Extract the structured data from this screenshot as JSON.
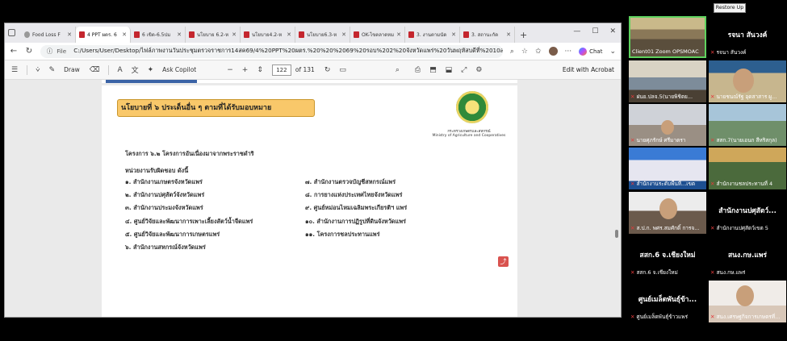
{
  "restore_button": "Restore Up",
  "browser": {
    "tabs": [
      {
        "label": "Food Loss F",
        "active": false
      },
      {
        "label": "4 PPT ผตร. 6",
        "active": true
      },
      {
        "label": "6 เขิต-6.5ปม",
        "active": false
      },
      {
        "label": "นโยบาย 6.2-ห",
        "active": false
      },
      {
        "label": "นโยบาย4.2-ห",
        "active": false
      },
      {
        "label": "นโยบาย6.3-ห",
        "active": false
      },
      {
        "label": "OK-ไขตลาดหม",
        "active": false
      },
      {
        "label": "3. งานตามนัด",
        "active": false
      },
      {
        "label": "3. สถานะกัด",
        "active": false
      }
    ],
    "new_tab": "+",
    "address": {
      "file_tag": "File",
      "url": "C:/Users/User/Desktop/ไฟล์ภาพงานวันประชุมตรวจราชการ14สค69/4%20PPT%20ผตร.%20%20%2069%20รอบ%202%20จังหวัดแพร่%20วันพฤหัสบดีที่%2010สค69%2021.55.pdf",
      "chat_label": "Chat"
    },
    "pdf_toolbar": {
      "draw_label": "Draw",
      "copilot_label": "Ask Copilot",
      "page_current": "122",
      "page_total": "of 131",
      "edit_label": "Edit with Acrobat"
    }
  },
  "document": {
    "policy_title": "นโยบายที่ ๖ ประเด็นอื่น ๆ ตามที่ได้รับมอบหมาย",
    "ministry_th": "กระทรวงเกษตรและสหกรณ์",
    "ministry_en": "Ministry of Agriculture and Cooperatives",
    "project_line": "โครงการ ๖.๒ โครงการอันเนื่องมาจากพระราชดำริ",
    "responsible_heading": "หน่วยงานรับผิดชอบ ดังนี้",
    "agencies_left": [
      "๑. สำนักงานเกษตรจังหวัดแพร่",
      "๒. สำนักงานปศุสัตว์จังหวัดแพร่",
      "๓. สำนักงานประมงจังหวัดแพร่",
      "๔. ศูนย์วิจัยและพัฒนาการเพาะเลี้ยงสัตว์น้ำจืดแพร่",
      "๕. ศูนย์วิจัยและพัฒนาการเกษตรแพร่",
      "๖. สำนักงานสหกรณ์จังหวัดแพร่"
    ],
    "agencies_right": [
      "๗. สำนักงานตรวจบัญชีสหกรณ์แพร่",
      "๘. การยางแห่งประเทศไทยจังหวัดแพร่",
      "๙. ศูนย์หม่อนไหมเฉลิมพระเกียรติฯ แพร่",
      "๑๐. สำนักงานการปฏิรูปที่ดินจังหวัดแพร่",
      "๑๑. โครงการชลประทานแพร่"
    ]
  },
  "zoom": {
    "participants": [
      {
        "name": "Client01 Zoom OPSMOAC",
        "type": "video"
      },
      {
        "name": "รจนา สันวงค์",
        "type": "name-only",
        "display": "รจนา สันวงค์"
      },
      {
        "name": "ฝนย.ปลจ.5(นายพิชิตย...",
        "type": "video"
      },
      {
        "name": "นายชนณ์รัฐ อุดสาสาร ผู...",
        "type": "video"
      },
      {
        "name": "นายศุภรักษ์ ศรีมาตรา",
        "type": "video"
      },
      {
        "name": "สสก.7(นายเอนก สีหริสกุล)",
        "type": "video"
      },
      {
        "name": "สำนักงานระดับพื้นที่...เขต",
        "type": "video"
      },
      {
        "name": "สำนักงานชลประทานที่ 4",
        "type": "video"
      },
      {
        "name": "ส.ป.ก. พศร.สมศักดิ์ การจ...",
        "type": "video"
      },
      {
        "name": "สำนักงานปศุสัตว์เขต 5",
        "type": "name-only",
        "display": "สำนักงานปศุสัตว์..."
      },
      {
        "name": "สสก.6 จ.เชียงใหม่",
        "type": "name-only",
        "display": "สสก.6 จ.เชียงใหม่"
      },
      {
        "name": "สนง.กษ.แพร่",
        "type": "name-only",
        "display": "สนง.กษ.แพร่"
      },
      {
        "name": "ศูนย์เมล็ดพันธุ์ข้าวแพร่",
        "type": "name-only",
        "display": "ศูนย์เมล็ดพันธุ์ข้า..."
      },
      {
        "name": "สนง.เศรษฐกิจการเกษตรที่...",
        "type": "video"
      }
    ]
  }
}
